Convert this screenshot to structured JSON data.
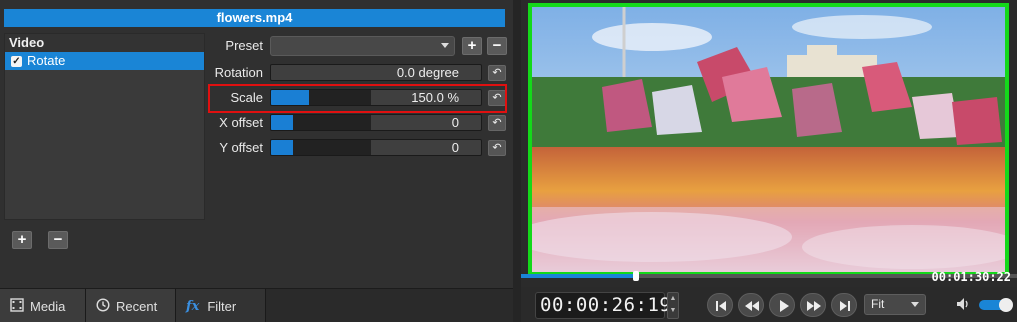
{
  "filter_panel": {
    "title": "flowers.mp4",
    "list_header": "Video",
    "filters": [
      {
        "label": "Rotate",
        "checked": true,
        "check_glyph": "✓"
      }
    ],
    "params": {
      "preset_label": "Preset",
      "preset_value": "",
      "rotation_label": "Rotation",
      "rotation_value": "0.0 degree",
      "scale_label": "Scale",
      "scale_value": "150.0 %",
      "x_offset_label": "X offset",
      "x_offset_value": "0",
      "y_offset_label": "Y offset",
      "y_offset_value": "0"
    },
    "add_glyph": "+",
    "remove_glyph": "−",
    "reset_glyph": "↶"
  },
  "tabs": [
    {
      "label": "Media",
      "icon": "film-icon"
    },
    {
      "label": "Recent",
      "icon": "clock-icon"
    },
    {
      "label": "Filter",
      "icon": "fx-icon",
      "icon_text": "fx"
    }
  ],
  "player": {
    "duration": "00:01:30:22",
    "timecode": "00:00:26:19",
    "zoom": "Fit",
    "position_fraction": 0.23,
    "volume_fraction": 0.9
  },
  "colors": {
    "accent": "#1a85d6",
    "highlight_border": "#e01010",
    "video_border": "#14d91a"
  }
}
